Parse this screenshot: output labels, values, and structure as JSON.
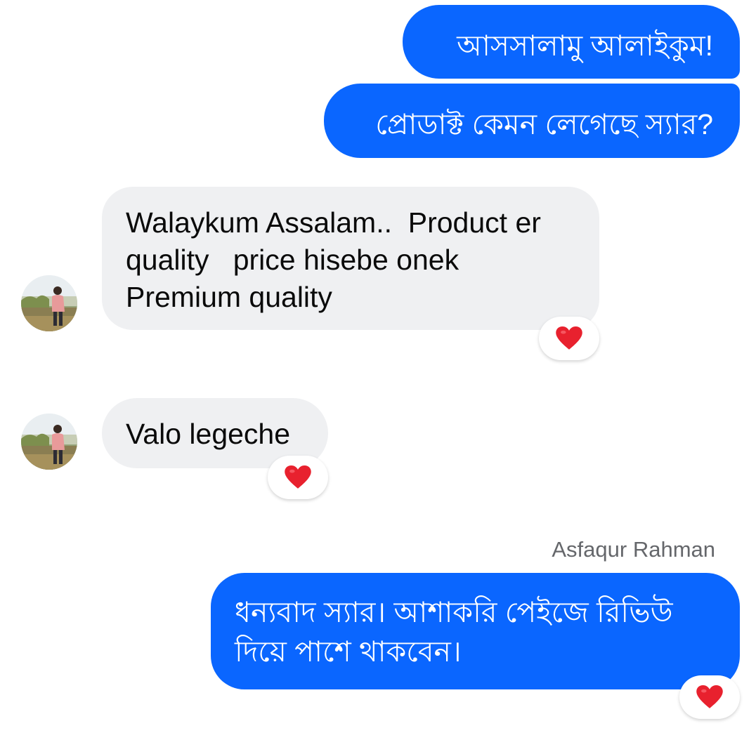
{
  "messages": [
    {
      "id": "m1",
      "direction": "outgoing",
      "text": "আসসালামু আলাইকুম!"
    },
    {
      "id": "m2",
      "direction": "outgoing",
      "text": "প্রোডাক্ট কেমন লেগেছে স্যার?"
    },
    {
      "id": "m3",
      "direction": "incoming",
      "text": "Walaykum Assalam..  Product er\nquality   price hisebe onek\nPremium quality",
      "reaction": "❤️"
    },
    {
      "id": "m4",
      "direction": "incoming",
      "text": "Valo legeche",
      "reaction": "❤️"
    },
    {
      "id": "m5",
      "direction": "outgoing",
      "sender_name": "Asfaqur Rahman",
      "text": "ধন্যবাদ স্যার। আশাকরি পেইজে রিভিউ\nদিয়ে পাশে থাকবেন।",
      "reaction": "❤️"
    }
  ],
  "colors": {
    "outgoing_bubble": "#0a66ff",
    "incoming_bubble": "#eff0f2",
    "reaction_heart": "#e8212e",
    "sender_name": "#65676b"
  },
  "icons": {
    "reaction": "heart-icon",
    "avatar": "contact-avatar"
  }
}
